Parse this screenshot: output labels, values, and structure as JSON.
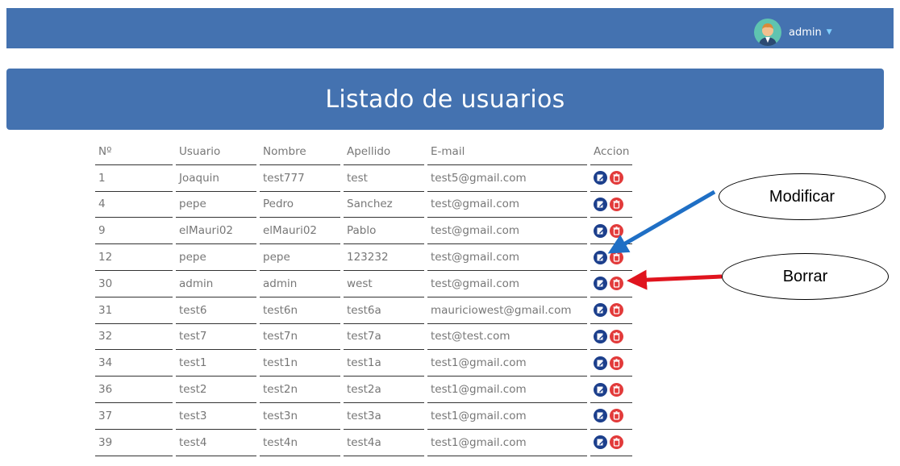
{
  "navbar": {
    "user": "admin"
  },
  "page": {
    "title": "Listado de usuarios"
  },
  "table": {
    "headers": [
      "Nº",
      "Usuario",
      "Nombre",
      "Apellido",
      "E-mail",
      "Accion"
    ],
    "rows": [
      [
        "1",
        "Joaquin",
        "test777",
        "test",
        "test5@gmail.com"
      ],
      [
        "4",
        "pepe",
        "Pedro",
        "Sanchez",
        "test@gmail.com"
      ],
      [
        "9",
        "elMauri02",
        "elMauri02",
        "Pablo",
        "test@gmail.com"
      ],
      [
        "12",
        "pepe",
        "pepe",
        "123232",
        "test@gmail.com"
      ],
      [
        "30",
        "admin",
        "admin",
        "west",
        "test@gmail.com"
      ],
      [
        "31",
        "test6",
        "test6n",
        "test6a",
        "mauriciowest@gmail.com"
      ],
      [
        "32",
        "test7",
        "test7n",
        "test7a",
        "test@test.com"
      ],
      [
        "34",
        "test1",
        "test1n",
        "test1a",
        "test1@gmail.com"
      ],
      [
        "36",
        "test2",
        "test2n",
        "test2a",
        "test1@gmail.com"
      ],
      [
        "37",
        "test3",
        "test3n",
        "test3a",
        "test1@gmail.com"
      ],
      [
        "39",
        "test4",
        "test4n",
        "test4a",
        "test1@gmail.com"
      ]
    ]
  },
  "annotations": {
    "modify": "Modificar",
    "delete": "Borrar"
  },
  "colors": {
    "navbar": "#4472b0",
    "edit_button": "#1c3f8c",
    "delete_button": "#e23a3a",
    "arrow_modify": "#1f6fc5",
    "arrow_delete": "#e0141e"
  },
  "icons": {
    "user_avatar": "avatar-icon",
    "edit": "edit-icon",
    "delete": "trash-icon",
    "dropdown": "caret-down-icon"
  }
}
